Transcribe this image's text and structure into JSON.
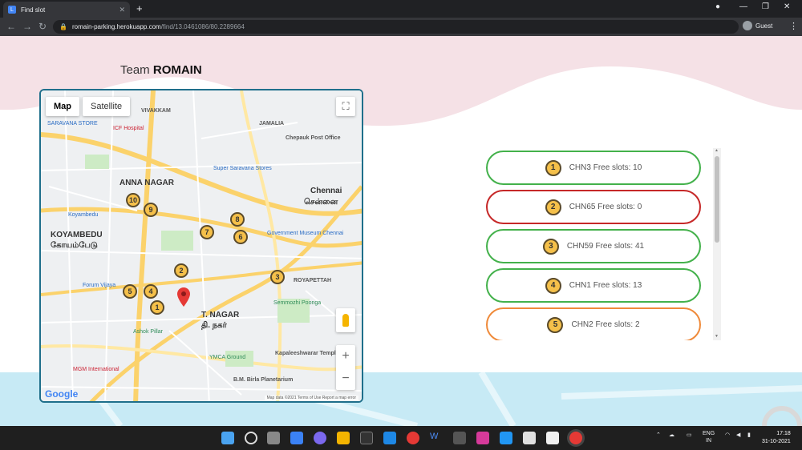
{
  "browser": {
    "tab_title": "Find slot",
    "tab_close": "✕",
    "new_tab": "+",
    "url_host": "romain-parking.herokuapp.com",
    "url_path": "/find/13.0461086/80.2289664",
    "profile_label": "Guest"
  },
  "page": {
    "team_prefix": "Team ",
    "team_name": "ROMAIN"
  },
  "map": {
    "map_button": "Map",
    "satellite_button": "Satellite",
    "zoom_in": "+",
    "zoom_out": "−",
    "google_logo": "Google",
    "attribution": "Map data ©2021   Terms of Use   Report a map error",
    "place_labels": [
      {
        "text": "VIVAKKAM",
        "cls": ""
      },
      {
        "text": "SARAVANA STORE",
        "cls": "blue"
      },
      {
        "text": "ICF Hospital",
        "cls": "red"
      },
      {
        "text": "JAMALIA",
        "cls": ""
      },
      {
        "text": "Chepauk Post Office",
        "cls": ""
      },
      {
        "text": "Super Saravana Stores",
        "cls": "blue"
      },
      {
        "text": "ANNA NAGAR",
        "cls": "big"
      },
      {
        "text": "Chennai",
        "cls": "big"
      },
      {
        "text": "சென்னை",
        "cls": "big"
      },
      {
        "text": "KOYAMBEDU",
        "cls": "big"
      },
      {
        "text": "கோயம்பேடு",
        "cls": "big"
      },
      {
        "text": "Koyambedu",
        "cls": ""
      },
      {
        "text": "Government Museum Chennai",
        "cls": "blue"
      },
      {
        "text": "Forum Vijaya",
        "cls": "blue"
      },
      {
        "text": "T. NAGAR",
        "cls": "big"
      },
      {
        "text": "தி. நகர்",
        "cls": "big"
      },
      {
        "text": "ROYAPETTAH",
        "cls": ""
      },
      {
        "text": "Semmozhi Poonga",
        "cls": "green"
      },
      {
        "text": "Ashok Pillar",
        "cls": "green"
      },
      {
        "text": "YMCA Ground",
        "cls": "green"
      },
      {
        "text": "MGM International",
        "cls": "red"
      },
      {
        "text": "Kapaleeshwarar Temple",
        "cls": ""
      },
      {
        "text": "B.M. Birla Planetarium",
        "cls": ""
      }
    ],
    "markers": [
      "10",
      "9",
      "8",
      "6",
      "7",
      "2",
      "5",
      "4",
      "1",
      "3"
    ]
  },
  "slots": [
    {
      "num": "1",
      "label": "CHN3 Free slots: 10",
      "status": "green"
    },
    {
      "num": "2",
      "label": "CHN65 Free slots: 0",
      "status": "red"
    },
    {
      "num": "3",
      "label": "CHN59 Free slots: 41",
      "status": "green"
    },
    {
      "num": "4",
      "label": "CHN1 Free slots: 13",
      "status": "green"
    },
    {
      "num": "5",
      "label": "CHN2 Free slots: 2",
      "status": "orange"
    }
  ],
  "colors": {
    "green": "#43b14b",
    "red": "#c62828",
    "orange": "#ef8a3a",
    "map_border": "#1f6f8b",
    "wave_pink": "#f5e1e6",
    "bottom_blue": "#c7eaf5"
  },
  "taskbar": {
    "lang_line1": "ENG",
    "lang_line2": "IN",
    "time": "17:18",
    "date": "31-10-2021"
  }
}
